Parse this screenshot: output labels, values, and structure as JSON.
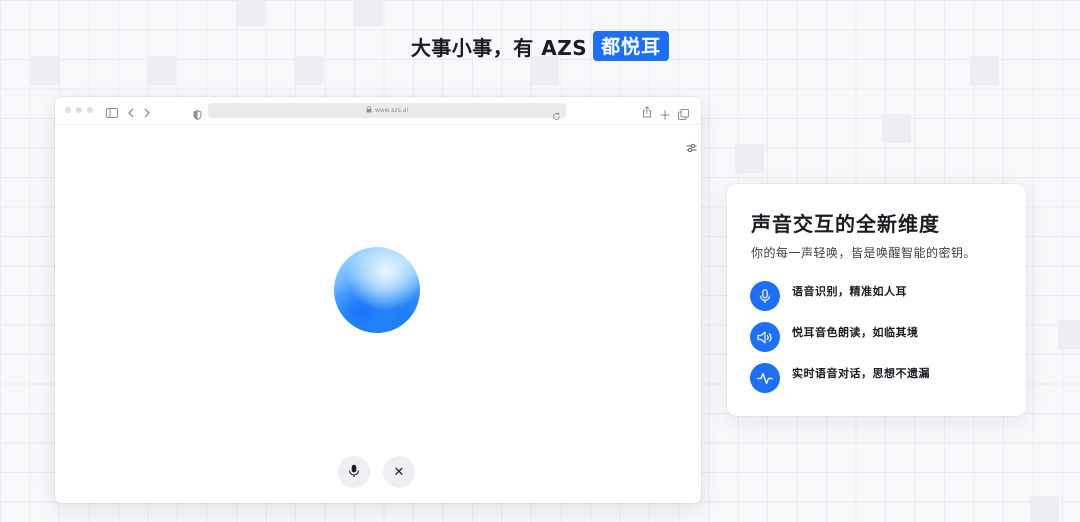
{
  "headline": {
    "text": "大事小事，有 AZS",
    "badge": "都悦耳"
  },
  "browser": {
    "url": "www.azs.ai"
  },
  "card": {
    "title": "声音交互的全新维度",
    "subtitle": "你的每一声轻唤，皆是唤醒智能的密钥。",
    "features": [
      {
        "icon": "microphone-icon",
        "label": "语音识别，精准如人耳"
      },
      {
        "icon": "speaker-icon",
        "label": "悦耳音色朗读，如临其境"
      },
      {
        "icon": "waveform-icon",
        "label": "实时语音对话，思想不遗漏"
      }
    ]
  },
  "colors": {
    "accent": "#1f6ff5",
    "background": "#f7f8fa",
    "text": "#1a1d23"
  }
}
